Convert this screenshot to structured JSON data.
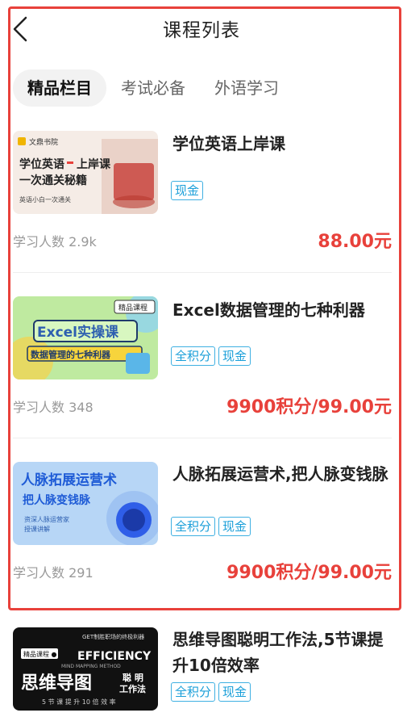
{
  "header": {
    "title": "课程列表"
  },
  "tabs": [
    {
      "label": "精品栏目",
      "active": true
    },
    {
      "label": "考试必备",
      "active": false
    },
    {
      "label": "外语学习",
      "active": false
    }
  ],
  "courses": [
    {
      "title": "学位英语上岸课",
      "tags": [
        "现金"
      ],
      "learners": "学习人数 2.9k",
      "price": "88.00元",
      "thumb": {
        "brand": "文鼎书院",
        "line1": "学位英语",
        "line1b": "上岸课",
        "line2": "一次通关秘籍",
        "line3": "英语小白一次通关"
      }
    },
    {
      "title": "Excel数据管理的七种利器",
      "tags": [
        "全积分",
        "现金"
      ],
      "learners": "学习人数 348",
      "price": "9900积分/99.00元",
      "thumb": {
        "badge": "精品课程",
        "line1": "Excel实操课",
        "line2": "数据管理的七种利器"
      }
    },
    {
      "title": "人脉拓展运营术,把人脉变钱脉",
      "tags": [
        "全积分",
        "现金"
      ],
      "learners": "学习人数 291",
      "price": "9900积分/99.00元",
      "thumb": {
        "line1": "人脉拓展运营术",
        "line2": "把人脉变钱脉",
        "line3": "资深人脉运营家",
        "line4": "授课讲解"
      }
    },
    {
      "title": "思维导图聪明工作法,5节课提升10倍效率",
      "tags": [
        "全积分",
        "现金"
      ],
      "thumb": {
        "badge": "精品课程 ●",
        "top": "GET制胜职场的终极利器",
        "line1": "EFFICIENCY",
        "line1s": "MIND MAPPING METHOD",
        "line2": "思维导图",
        "line2b": "聪 明",
        "line2c": "工作法",
        "line3": "5 节 课 提 升 10 倍 效 率"
      }
    }
  ],
  "colors": {
    "accent": "#e8413b",
    "tag": "#1a9fd9",
    "highlight_border": "#e8413b"
  },
  "icons": {
    "back": "chevron-left-icon"
  }
}
